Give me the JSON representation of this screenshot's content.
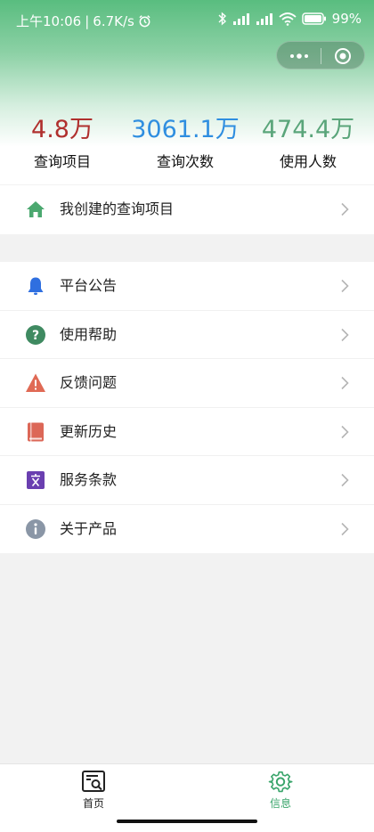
{
  "status_bar": {
    "time": "上午10:06",
    "separator": "|",
    "speed": "6.7K/s",
    "battery": "99%"
  },
  "stats": [
    {
      "value": "4.8万",
      "label": "查询项目",
      "color": "#b0302e"
    },
    {
      "value": "3061.1万",
      "label": "查询次数",
      "color": "#2f8ee0"
    },
    {
      "value": "474.4万",
      "label": "使用人数",
      "color": "#5aa57a"
    }
  ],
  "menu_primary": [
    {
      "label": "我创建的查询项目",
      "icon": "house-icon"
    }
  ],
  "menu_secondary": [
    {
      "label": "平台公告",
      "icon": "bell-icon"
    },
    {
      "label": "使用帮助",
      "icon": "question-icon"
    },
    {
      "label": "反馈问题",
      "icon": "warning-icon"
    },
    {
      "label": "更新历史",
      "icon": "book-icon"
    },
    {
      "label": "服务条款",
      "icon": "document-icon"
    },
    {
      "label": "关于产品",
      "icon": "info-icon"
    }
  ],
  "tabbar": {
    "home_label": "首页",
    "info_label": "信息",
    "active_color": "#3aa56b"
  }
}
